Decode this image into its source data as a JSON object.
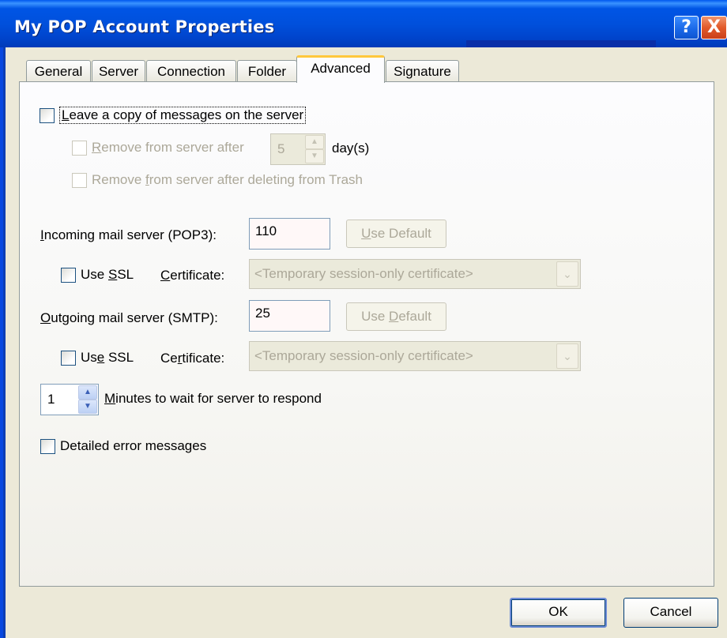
{
  "window": {
    "title": "My POP Account Properties",
    "help_label": "?",
    "close_label": "X"
  },
  "tabs": [
    {
      "label": "General",
      "active": false
    },
    {
      "label": "Server",
      "active": false
    },
    {
      "label": "Connection",
      "active": false
    },
    {
      "label": "Folder",
      "active": false
    },
    {
      "label": "Advanced",
      "active": true
    },
    {
      "label": "Signature",
      "active": false
    }
  ],
  "leave_copy": {
    "label_u": "L",
    "label_rest": "eave a copy of messages on the server",
    "checked": false
  },
  "remove_after": {
    "label_u": "R",
    "label_rest": "emove from server after",
    "days_value": "5",
    "days_label": "day(s)",
    "enabled": false,
    "checked": false
  },
  "remove_trash": {
    "label_pre": "Remove ",
    "label_u": "f",
    "label_rest": "rom server after deleting from Trash",
    "enabled": false,
    "checked": false
  },
  "incoming": {
    "label_u": "I",
    "label_rest": "ncoming mail server (POP3):",
    "port": "110",
    "default_u": "U",
    "default_rest": "se Default",
    "ssl_pre": "Use ",
    "ssl_u": "S",
    "ssl_rest": "SL",
    "cert_u": "C",
    "cert_rest": "ertificate:",
    "cert_value": "<Temporary session-only certificate>"
  },
  "outgoing": {
    "label_u": "O",
    "label_rest": "utgoing mail server (SMTP):",
    "port": "25",
    "default_pre": "Use ",
    "default_u": "D",
    "default_rest": "efault",
    "ssl_pre": "Us",
    "ssl_u": "e",
    "ssl_rest": " SSL",
    "cert_pre": "Ce",
    "cert_u": "r",
    "cert_rest": "tificate:",
    "cert_value": "<Temporary session-only certificate>"
  },
  "timeout": {
    "value": "1",
    "label_u": "M",
    "label_rest": "inutes to wait for server to respond"
  },
  "detailed_errors": {
    "label": "Detailed error messages",
    "checked": false
  },
  "footer": {
    "ok_label": "OK",
    "cancel_label": "Cancel"
  },
  "icons": {
    "spin_up": "▲",
    "spin_down": "▼",
    "combo_arrow": "⌄"
  }
}
